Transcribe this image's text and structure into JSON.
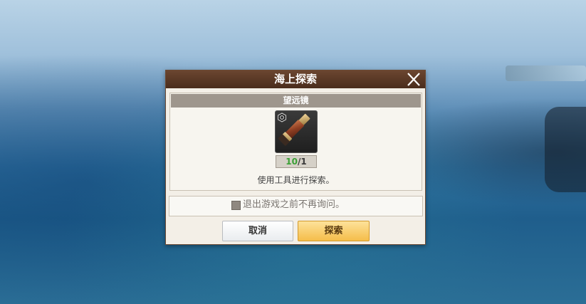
{
  "dialog": {
    "title": "海上探索",
    "close_icon": "close-icon"
  },
  "item": {
    "name": "望远镜",
    "icon": "telescope-icon",
    "badge_icon": "item-badge-icon",
    "count_have": "10",
    "count_sep": "/",
    "count_need": "1",
    "description": "使用工具进行探索。"
  },
  "option": {
    "label": "退出游戏之前不再询问。",
    "checked": false
  },
  "buttons": {
    "cancel": "取消",
    "explore": "探索"
  },
  "colors": {
    "titlebar": "#4a2d1c",
    "count_have": "#3aa035",
    "explore_button": "#f5bd4a"
  }
}
